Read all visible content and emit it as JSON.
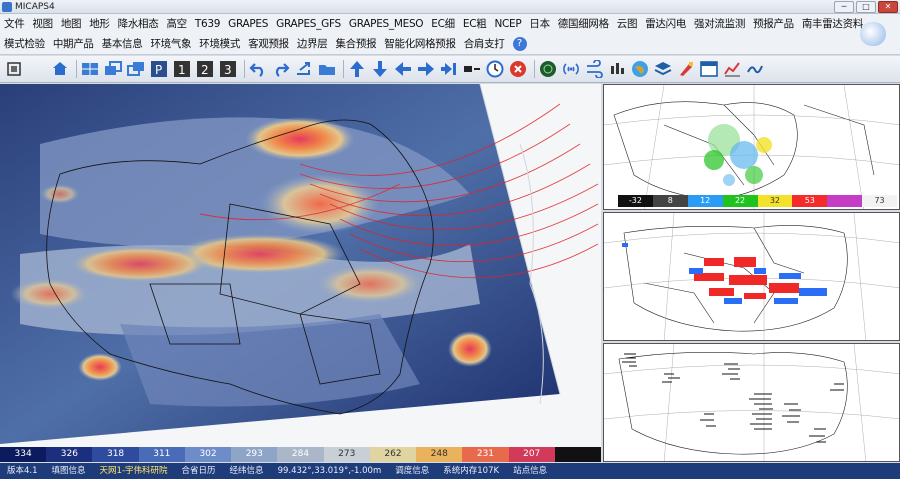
{
  "window": {
    "title": "MICAPS4",
    "minimize": "─",
    "maximize": "□",
    "close": "✕"
  },
  "menu_row1": [
    "文件",
    "视图",
    "地图",
    "地形",
    "降水相态",
    "高空",
    "T639",
    "GRAPES",
    "GRAPES_GFS",
    "GRAPES_MESO",
    "EC细",
    "EC粗",
    "NCEP",
    "日本",
    "德国细网格",
    "云图",
    "雷达闪电",
    "强对流监测",
    "预报产品",
    "南丰雷达资料"
  ],
  "menu_row2": [
    "模式检验",
    "中期产品",
    "基本信息",
    "环境气象",
    "环境模式",
    "客观预报",
    "边界层",
    "集合预报",
    "智能化网格预报",
    "合肩支打"
  ],
  "help_label": "?",
  "toolbar_icons": [
    "grid-view-icon",
    "moon-icon",
    "home-icon",
    "layout-icon",
    "window-icon",
    "restore-icon",
    "frame-icon",
    "frame1-icon",
    "frame2-icon",
    "frame3-icon",
    "undo-icon",
    "redo-icon",
    "export-icon",
    "folder-icon",
    "arrow-up-icon",
    "arrow-down-icon",
    "arrow-left-icon",
    "arrow-right-icon",
    "step-end-icon",
    "settings-icon",
    "clock-icon",
    "stop-icon",
    "radar-icon",
    "signal-icon",
    "wind-icon",
    "chart-icon",
    "globe-icon",
    "layers-icon",
    "paint-icon",
    "panel-icon",
    "graph-icon",
    "line-chart-icon"
  ],
  "colorbar": {
    "labels": [
      "334",
      "326",
      "318",
      "311",
      "302",
      "293",
      "284",
      "273",
      "262",
      "248",
      "231",
      "207",
      ""
    ],
    "colors": [
      "#0b1b5e",
      "#1c2f7e",
      "#2e4b9e",
      "#4a6bb8",
      "#6e8cc8",
      "#8ea5c8",
      "#a9b7c8",
      "#c8cfd6",
      "#e0d5a0",
      "#eab25d",
      "#e86a4c",
      "#d23a5a",
      "#111111"
    ]
  },
  "panel1_colorbar": {
    "labels": [
      "-32",
      "8",
      "12",
      "22",
      "32",
      "53",
      "",
      "73"
    ],
    "colors": [
      "#111111",
      "#444444",
      "#2a9cf5",
      "#1fc21f",
      "#f4e22a",
      "#f52a2a",
      "#c43dc4",
      "#f2f2f2"
    ]
  },
  "status": [
    "版本4.1",
    "填图信息",
    "天网1-宇伟科研院",
    "合省日历",
    "经纬信息",
    "99.432°,33.019°,-1.00m",
    "调度信息",
    "系统内存107K",
    "站点信息"
  ],
  "colors": {
    "status_bg": "#1f3c7a",
    "accent": "#3c78d8"
  }
}
